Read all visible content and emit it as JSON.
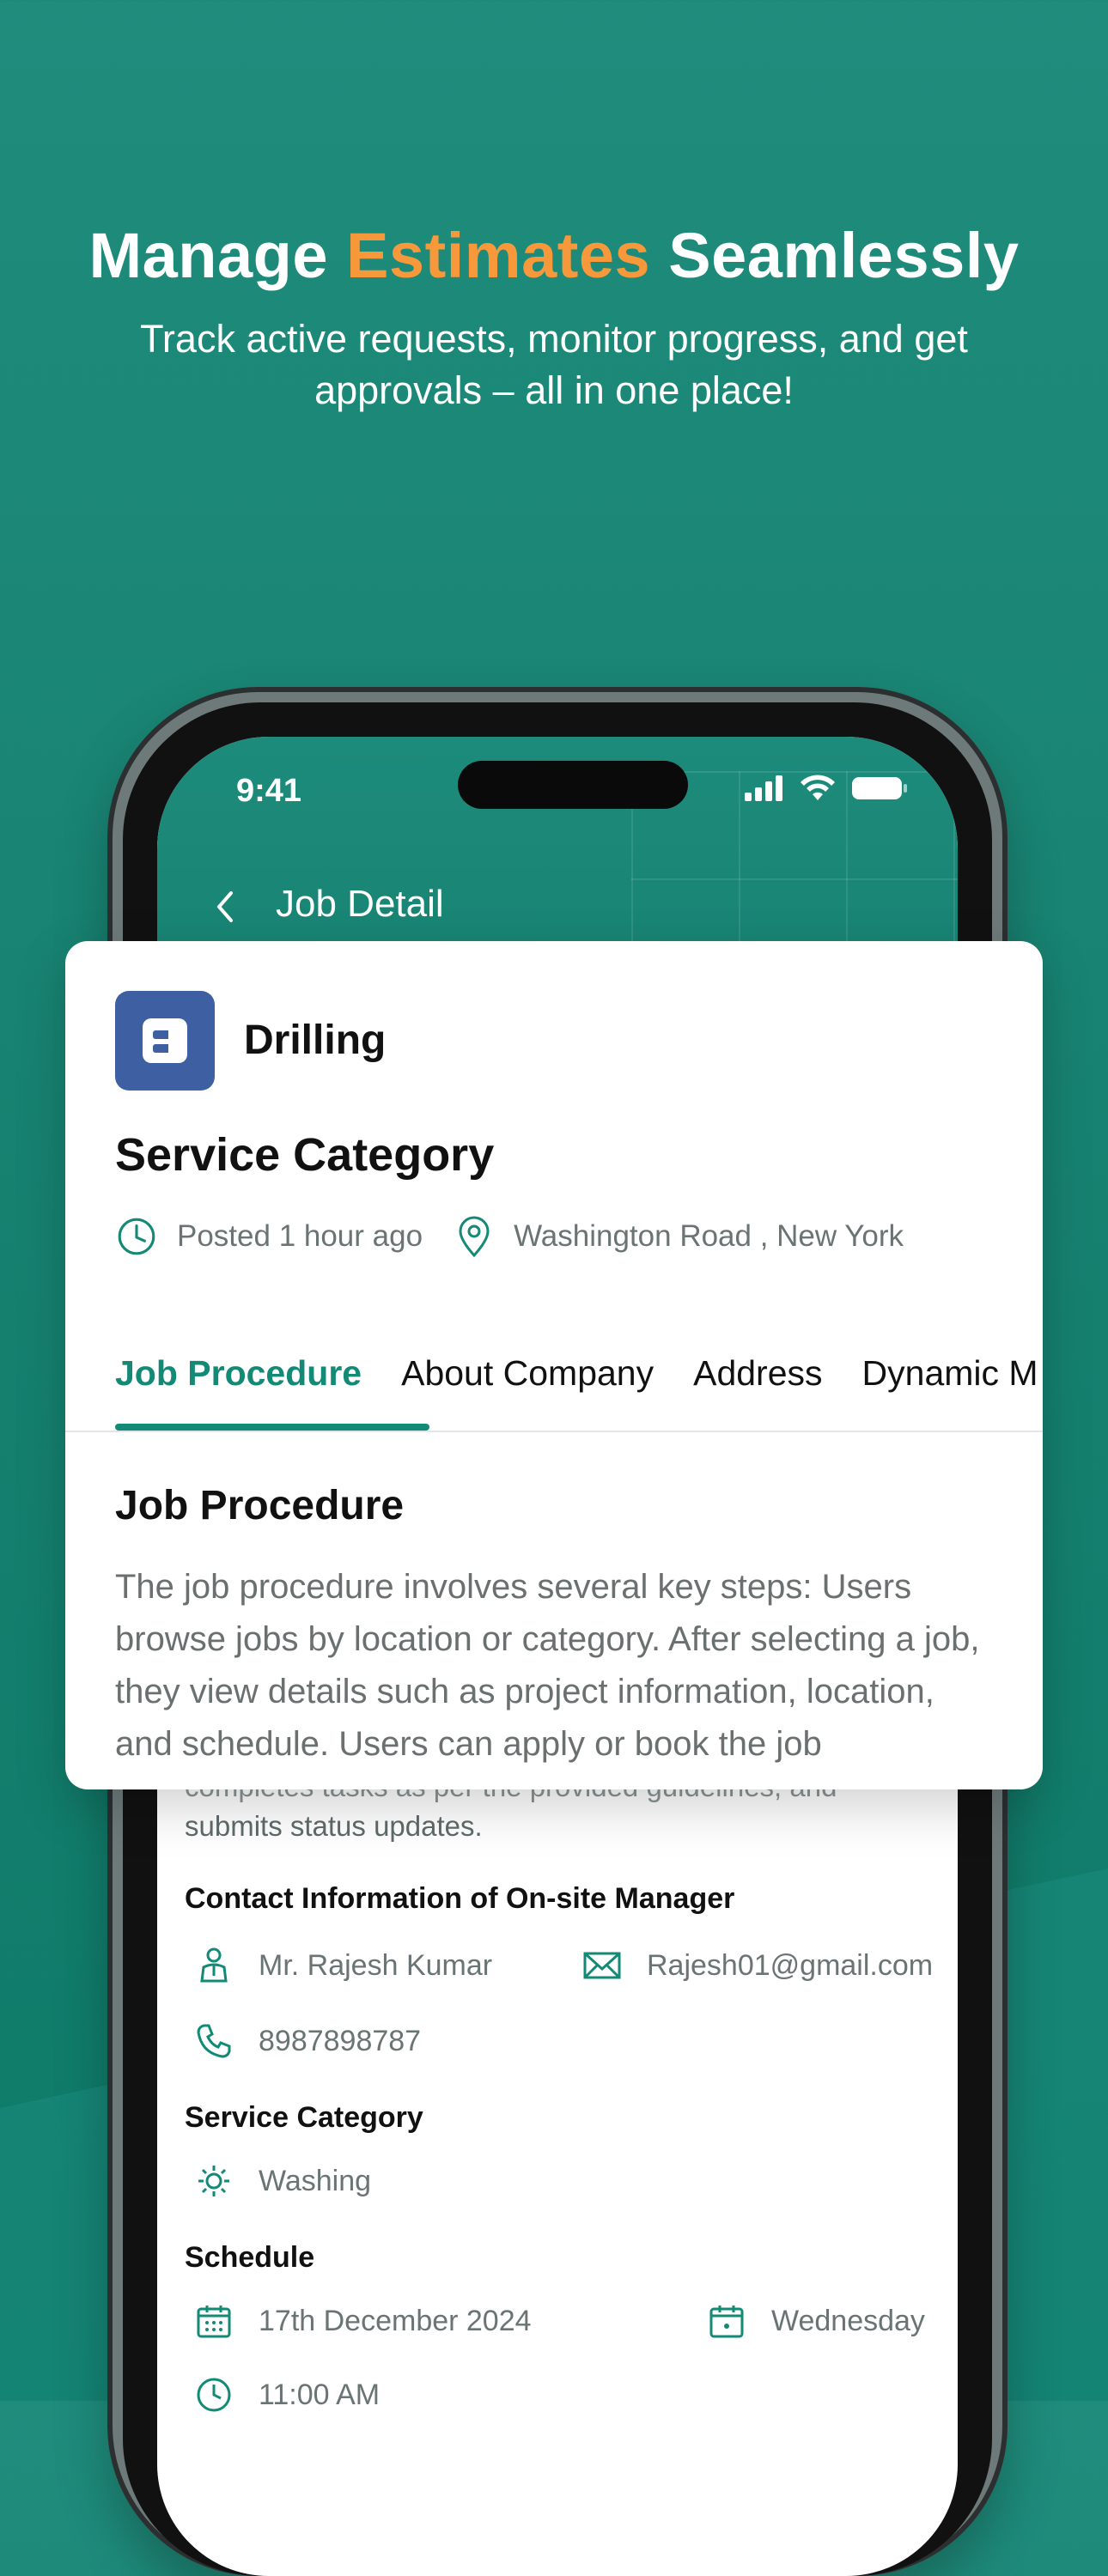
{
  "hero": {
    "title_part1": "Manage",
    "title_accent": "Estimates",
    "title_part2": "Seamlessly",
    "subtitle": "Track active requests, monitor progress, and get approvals – all in one place!"
  },
  "colors": {
    "brand": "#138a75",
    "accent": "#f7993b",
    "logo_bg": "#3f5fa3"
  },
  "status_bar": {
    "time": "9:41"
  },
  "nav": {
    "title": "Job Detail"
  },
  "card": {
    "company": "Drilling",
    "title": "Service Category",
    "posted": "Posted 1 hour ago",
    "location": "Washington Road , New York",
    "tabs": [
      {
        "label": "Job Procedure",
        "active": true
      },
      {
        "label": "About Company",
        "active": false
      },
      {
        "label": "Address",
        "active": false
      },
      {
        "label": "Dynamic M",
        "active": false
      }
    ],
    "section_title": "Job Procedure",
    "section_text": "The job procedure involves several key steps: Users browse jobs by location or category. After selecting a job, they view details such as project information, location, and schedule. Users can apply or book the job"
  },
  "details": {
    "faded_text_line1": "completes tasks as per the provided guidelines, and",
    "faded_text_line2": "submits status updates.",
    "contact_title": "Contact Information of On-site Manager",
    "contact_name": "Mr. Rajesh Kumar",
    "contact_email": "Rajesh01@gmail.com",
    "contact_phone": "8987898787",
    "service_title": "Service Category",
    "service_value": "Washing",
    "schedule_title": "Schedule",
    "schedule_date": "17th December 2024",
    "schedule_day": "Wednesday",
    "schedule_time": "11:00 AM"
  }
}
